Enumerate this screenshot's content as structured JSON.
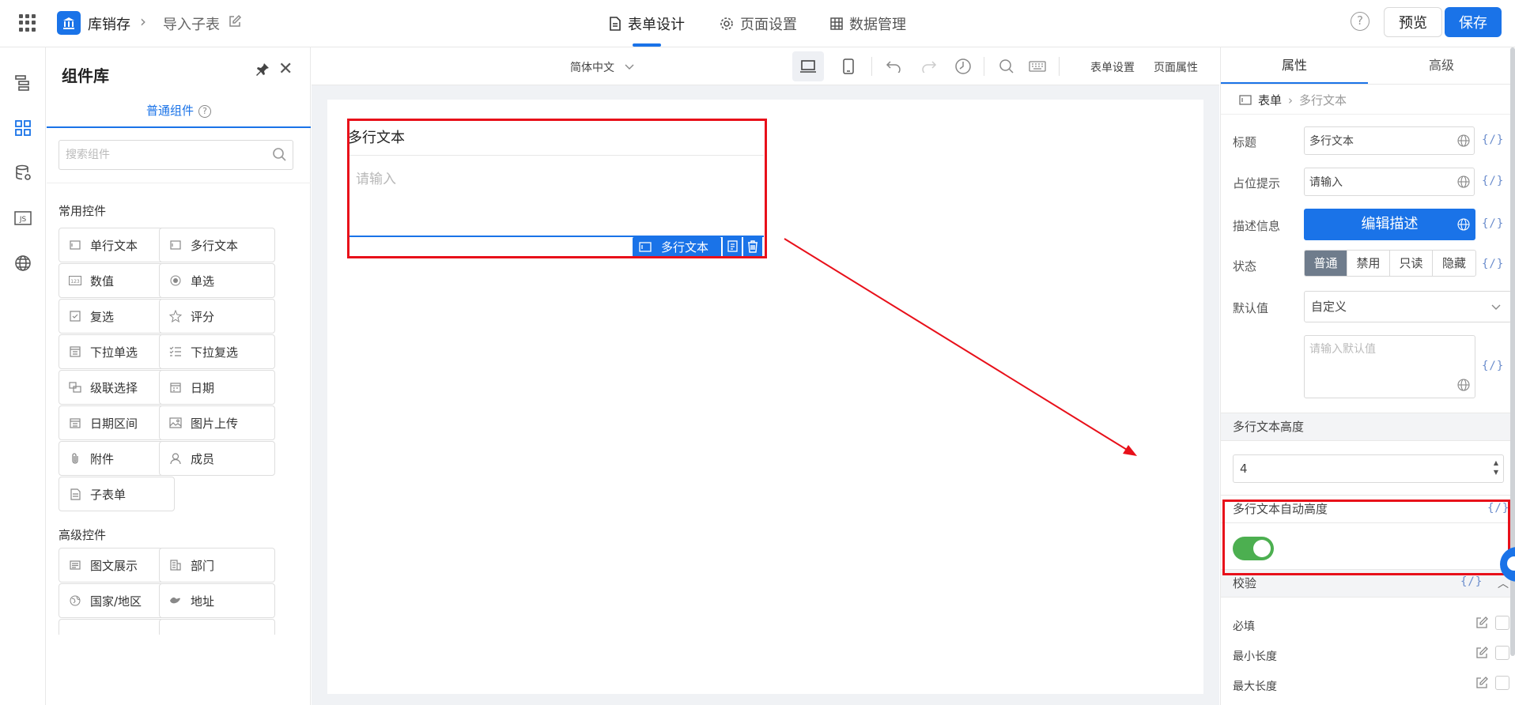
{
  "topbar": {
    "app_name": "库销存",
    "breadcrumb_sub": "导入子表",
    "tabs": [
      {
        "label": "表单设计",
        "icon": "document-icon",
        "active": true
      },
      {
        "label": "页面设置",
        "icon": "gear-icon",
        "active": false
      },
      {
        "label": "数据管理",
        "icon": "table-icon",
        "active": false
      }
    ],
    "preview_label": "预览",
    "save_label": "保存",
    "help_glyph": "?"
  },
  "library": {
    "title": "组件库",
    "tab_label": "普通组件",
    "search_placeholder": "搜索组件",
    "section_common": "常用控件",
    "section_advanced": "高级控件",
    "common": [
      "单行文本",
      "多行文本",
      "数值",
      "单选",
      "复选",
      "评分",
      "下拉单选",
      "下拉复选",
      "级联选择",
      "日期",
      "日期区间",
      "图片上传",
      "附件",
      "成员",
      "子表单"
    ],
    "advanced": [
      "图文展示",
      "部门",
      "国家/地区",
      "地址"
    ]
  },
  "toolbar": {
    "language": "简体中文",
    "form_settings": "表单设置",
    "page_props": "页面属性"
  },
  "canvas": {
    "field_label": "多行文本",
    "field_placeholder": "请输入",
    "field_tag": "多行文本"
  },
  "panel": {
    "tab_props": "属性",
    "tab_advanced": "高级",
    "crumb_form": "表单",
    "crumb_current": "多行文本",
    "label_title": "标题",
    "title_value": "多行文本",
    "label_placeholder": "占位提示",
    "placeholder_value": "请输入",
    "label_desc": "描述信息",
    "edit_desc": "编辑描述",
    "label_state": "状态",
    "states": [
      "普通",
      "禁用",
      "只读",
      "隐藏"
    ],
    "label_default": "默认值",
    "default_mode": "自定义",
    "default_placeholder": "请输入默认值",
    "section_height": "多行文本高度",
    "height_value": "4",
    "section_auto": "多行文本自动高度",
    "auto_enabled": true,
    "section_validation": "校验",
    "rules": [
      "必填",
      "最小长度",
      "最大长度"
    ],
    "code_glyph": "{/}"
  },
  "colors": {
    "accent": "#1a73e8",
    "highlight": "#e8101a",
    "toggle_on": "#4caf50"
  }
}
